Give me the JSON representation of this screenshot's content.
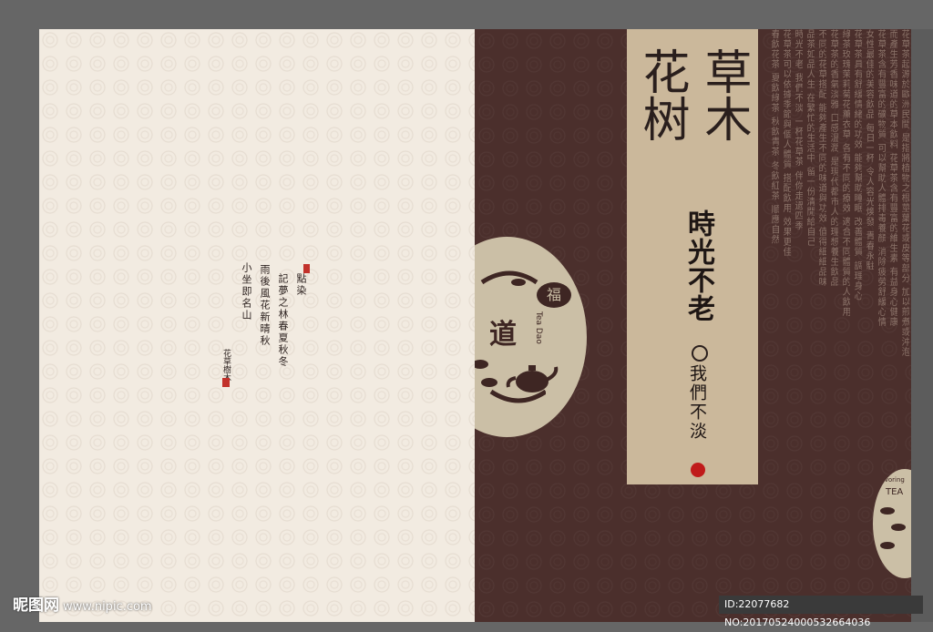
{
  "title_chars": [
    "草木",
    "花树"
  ],
  "subtitle": "時光不老",
  "subtitle2": "我們不淡",
  "calligraphy": {
    "lines": [
      "點染",
      "記夢之林春夏秋冬",
      "雨後風花新晴秋",
      "小坐即名山"
    ],
    "signature": "花草樹木"
  },
  "emblem": {
    "stamp": "福",
    "big_char": "道",
    "english": "Tea Dao"
  },
  "emblem_small": {
    "text1": "Savoring",
    "text2": "TEA"
  },
  "text_columns": [
    "花草茶起源於歐洲民間  是指將植物之根莖葉花或皮等部分  加以煎煮或沖泡",
    "而產生芳香味道的草本飲料  花草茶含有豐富的維生素  有益身心健康",
    "花草茶含有豐富的礦物質  可以幫助人體排毒養顏  消除疲勞舒緩心情",
    "女性最佳的美容飲品  每日一杯  令人容光煥發  青春永駐",
    "花草茶具有舒緩情緒的功效  能夠幫助睡眠  改善體質  調理身心",
    "綠茶玫瑰茉莉菊花薰衣草  各有不同的療效  適合不同體質的人飲用",
    "花草茶的香氣淡雅  口感溫潤  是現代都市人的理想養生飲品",
    "不同的花草搭配  能夠產生不同的味道與功效  值得細細品味",
    "品茶如品人生  在繁忙的生活中  留一份清閒給自己",
    "時光不老  我們不淡  一杯花草茶  伴你走過四季",
    "花草茶可以依據季節與個人體質  搭配飲用  效果更佳",
    "春飲花茶  夏飲綠茶  秋飲青茶  冬飲紅茶  順應自然"
  ],
  "watermark": {
    "brand": "昵图网",
    "url": "www.nipic.com"
  },
  "id_text": "ID:22077682 NO:20170524000532664036"
}
